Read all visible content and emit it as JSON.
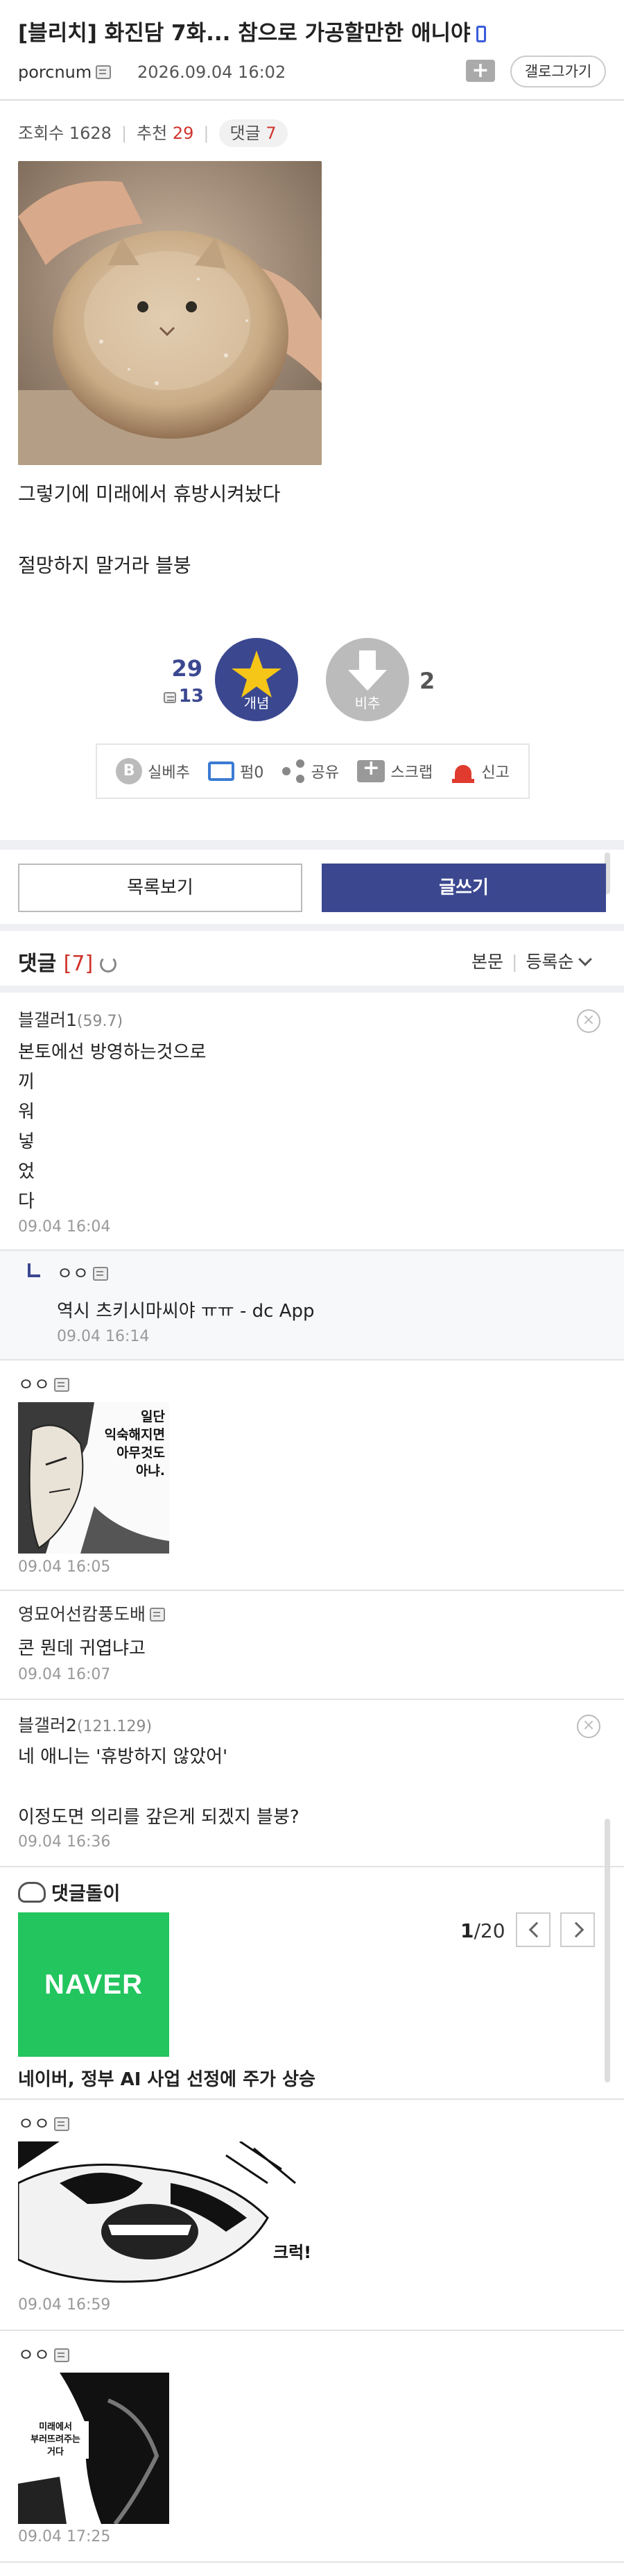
{
  "post": {
    "title": "[블리치] 화진담 7화... 참으로 가공할만한 애니야",
    "author": "porcnum",
    "datetime": "2026.09.04 16:02",
    "gallery_button": "갤로그가기",
    "views_label": "조회수 1628",
    "recommend_label": "추천",
    "recommend_count": "29",
    "comment_label": "댓글",
    "comment_count": "7",
    "body": [
      "그렇기에 미래에서 휴방시켜놨다",
      "절망하지 말거라 블붕"
    ]
  },
  "vote": {
    "up_count": "29",
    "mobile_up_count": "13",
    "up_label": "개념",
    "down_label": "비추",
    "down_count": "2"
  },
  "actions": {
    "b_icon": "B",
    "b_label": "실베추",
    "repost_label": "펌0",
    "share_label": "공유",
    "scrap_label": "스크랩",
    "report_label": "신고"
  },
  "buttons": {
    "list": "목록보기",
    "write": "글쓰기"
  },
  "comments_header": {
    "title": "댓글",
    "count": "[7]",
    "sort_body": "본문",
    "sort_order": "등록순"
  },
  "comments": [
    {
      "nick": "블갤러1",
      "ip": "(59.7)",
      "lines": [
        "본토에선 방영하는것으로",
        "끼",
        "워",
        "넣",
        "었",
        "다"
      ],
      "time": "09.04 16:04"
    },
    {
      "nick": "ㅇㅇ",
      "text": "역시 츠키시마씨야 ㅠㅠ - dc App",
      "time": "09.04 16:14"
    },
    {
      "nick": "ㅇㅇ",
      "image_text": [
        "일단",
        "익숙해지면",
        "아무것도",
        "아냐."
      ],
      "time": "09.04 16:05"
    },
    {
      "nick": "영묘어선캄풍도배",
      "text": "콘 뭔데 귀엽냐고",
      "time": "09.04 16:07"
    },
    {
      "nick": "블갤러2",
      "ip": "(121.129)",
      "lines": [
        "네 애니는 '휴방하지 않았어'",
        "이정도면 의리를 갚은게 되겠지 블붕?"
      ],
      "time": "09.04 16:36"
    },
    {
      "nick": "ㅇㅇ",
      "image_text": "크럭!",
      "time": "09.04 16:59"
    },
    {
      "nick": "ㅇㅇ",
      "image_text": [
        "미래에서",
        "부러뜨려주는",
        "거다"
      ],
      "time": "09.04 17:25"
    }
  ],
  "related": {
    "title": "댓글돌이",
    "logo_text": "NAVER",
    "page_current": "1",
    "page_total": "/20",
    "headline": "네이버, 정부 AI 사업 선정에 주가 상승"
  },
  "colors": {
    "accent": "#3b4890",
    "red": "#d0342c",
    "naver": "#22c55e"
  }
}
